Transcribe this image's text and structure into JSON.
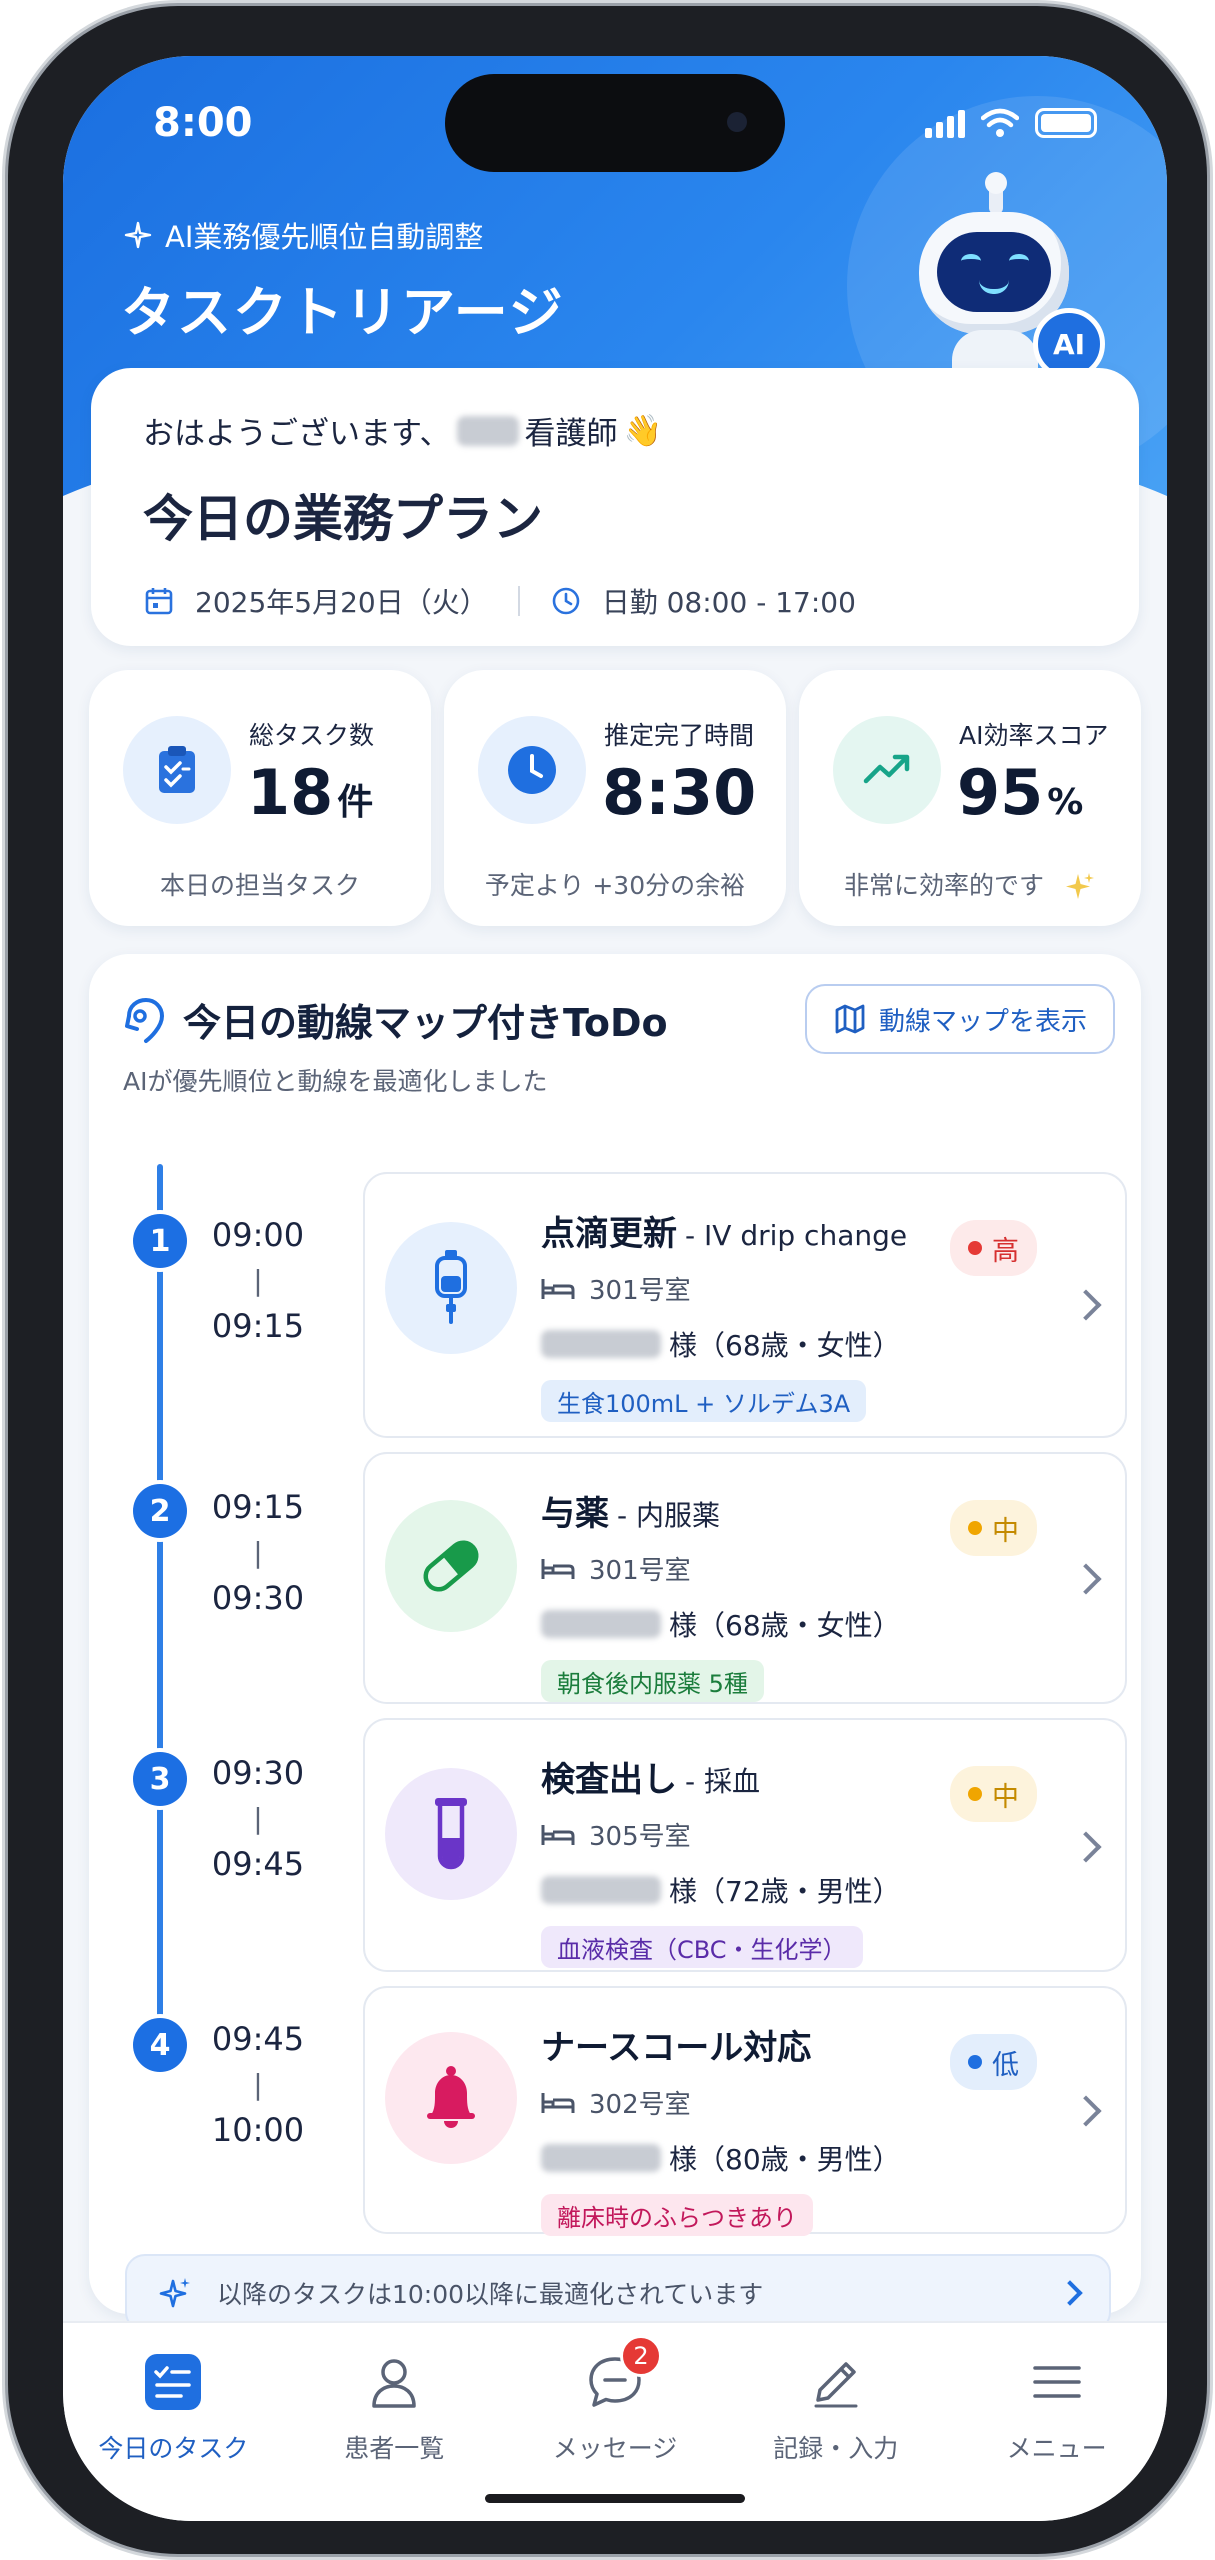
{
  "status": {
    "time": "8:00"
  },
  "header": {
    "subtitle": "AI業務優先順位自動調整",
    "title": "タスクトリアージ",
    "ai_badge": "AI"
  },
  "greeting": {
    "prefix": "おはようございます、",
    "suffix": "看護師",
    "emoji": "👋",
    "title": "今日の業務プラン",
    "date": "2025年5月20日（火）",
    "shift": "日勤 08:00 - 17:00"
  },
  "stats": [
    {
      "label": "総タスク数",
      "value": "18",
      "unit": "件",
      "note": "本日の担当タスク",
      "icon": "clipboard-check-icon"
    },
    {
      "label": "推定完了時間",
      "value": "8:30",
      "unit": "",
      "note": "予定より +30分の余裕",
      "icon": "clock-icon"
    },
    {
      "label": "AI効率スコア",
      "value": "95",
      "unit": "%",
      "note": "非常に効率的です",
      "icon": "trend-up-icon"
    }
  ],
  "todo": {
    "title": "今日の動線マップ付きToDo",
    "subtitle": "AIが優先順位と動線を最適化しました",
    "map_button": "動線マップを表示",
    "tasks": [
      {
        "num": "1",
        "start": "09:00",
        "end": "09:15",
        "title": "点滴更新",
        "title_en": "- IV drip change",
        "room": "301号室",
        "patient": "様（68歳・女性）",
        "tag": "生食100mL + ソルデム3A",
        "priority": "高",
        "icon": "iv-drip-icon"
      },
      {
        "num": "2",
        "start": "09:15",
        "end": "09:30",
        "title": "与薬",
        "title_en": "- 内服薬",
        "room": "301号室",
        "patient": "様（68歳・女性）",
        "tag": "朝食後内服薬 5種",
        "priority": "中",
        "icon": "pill-icon"
      },
      {
        "num": "3",
        "start": "09:30",
        "end": "09:45",
        "title": "検査出し",
        "title_en": "- 採血",
        "room": "305号室",
        "patient": "様（72歳・男性）",
        "tag": "血液検査（CBC・生化学）",
        "priority": "中",
        "icon": "test-tube-icon"
      },
      {
        "num": "4",
        "start": "09:45",
        "end": "10:00",
        "title": "ナースコール対応",
        "title_en": "",
        "room": "302号室",
        "patient": "様（80歳・男性）",
        "tag": "離床時のふらつきあり",
        "priority": "低",
        "icon": "bell-icon"
      }
    ],
    "time_separator": "|",
    "banner": "以降のタスクは10:00以降に最適化されています"
  },
  "nav": [
    {
      "label": "今日のタスク",
      "icon": "task-list-icon",
      "active": true
    },
    {
      "label": "患者一覧",
      "icon": "person-icon"
    },
    {
      "label": "メッセージ",
      "icon": "chat-icon",
      "badge": "2"
    },
    {
      "label": "記録・入力",
      "icon": "pencil-icon"
    },
    {
      "label": "メニュー",
      "icon": "menu-icon"
    }
  ],
  "colors": {
    "primary": "#1f6fe0",
    "priority_high": "#e53935",
    "priority_mid": "#f0a500",
    "priority_low": "#1f6fe0"
  }
}
